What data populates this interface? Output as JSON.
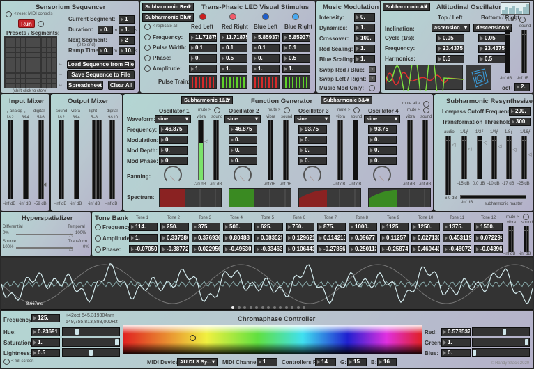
{
  "sequencer": {
    "title": "Sensorium Sequencer",
    "reset_midi": "< reset MIDI controls",
    "run": "Run",
    "presets_label": "Presets / Segments:",
    "shift_hint": "(shift-click to store)",
    "current_segment_label": "Current Segment:",
    "current_segment": "1",
    "duration_label": "Duration:",
    "duration_m": "0.",
    "duration_s": "1.",
    "next_segment_label": "Next Segment:",
    "next_segment_hint": "(0 to end)",
    "next_segment": "2",
    "ramp_label": "Ramp Time:",
    "ramp_m": "0.",
    "ramp_s": "10.",
    "unit_m": "m",
    "unit_s": "s",
    "load": "Load Sequence from File",
    "save": "Save Sequence to File",
    "spreadsheet": "Spreadsheet",
    "clear": "Clear All"
  },
  "led": {
    "title": "Trans-Phasic LED Visual Stimulus",
    "dropdown_red": "Subharmonic Red",
    "dropdown_blue": "Subharmonic Blue",
    "replicate": "< replicate all",
    "led_colors": [
      "#cc1f1f",
      "#f05a6a",
      "#1f5fcc",
      "#4aa8f0"
    ],
    "columns": [
      "Red Left",
      "Red Right",
      "Blue Left",
      "Blue Right"
    ],
    "rows": [
      {
        "label": "Frequency:",
        "values": [
          "11.71875",
          "11.71875",
          "5.859375",
          "5.859375"
        ]
      },
      {
        "label": "Pulse Width:",
        "values": [
          "0.1",
          "0.1",
          "0.1",
          "0.1"
        ]
      },
      {
        "label": "Phase:",
        "values": [
          "0.",
          "0.5",
          "0.",
          "0.5"
        ]
      },
      {
        "label": "Amplitude:",
        "values": [
          "1.",
          "1.",
          "1.",
          "1."
        ]
      }
    ],
    "pulse_train_label": "Pulse Train:",
    "pulse_colors": [
      "#d62a2a",
      "#5fd12a",
      "#d62a2a",
      "#5fd12a"
    ]
  },
  "music_mod": {
    "title": "Music Modulation",
    "rows": [
      {
        "label": "Intensity:",
        "value": "0."
      },
      {
        "label": "Dynamics:",
        "value": "1."
      },
      {
        "label": "Crossover:",
        "value": "100."
      },
      {
        "label": "Red Scaling:",
        "value": "1."
      },
      {
        "label": "Blue Scaling:",
        "value": "1."
      }
    ],
    "swap_rb": "Swap Red / Blue:",
    "swap_lr": "Swap Left / Right:",
    "mod_only": "Music Mod Only:"
  },
  "altitudinal": {
    "title": "Altitudinal Oscillator",
    "dropdown": "Subharmonic All",
    "top_left": "Top / Left",
    "bottom_right": "Bottom / Right",
    "inclination_label": "Inclination:",
    "inclination": [
      "ascension",
      "descension"
    ],
    "cycle_label": "Cycle (1/s):",
    "cycle": [
      "0.05",
      "0.05"
    ],
    "frequency_label": "Frequency:",
    "frequency": [
      "23.4375",
      "23.4375"
    ],
    "harmonics_label": "Harmonics:",
    "harmonics": [
      "0.5",
      "0.5"
    ],
    "mute": "mute >",
    "vibra": "vibra",
    "sound": "sound",
    "db": [
      "-inf dB",
      "-inf dB"
    ],
    "oct_label": "oct+:",
    "oct": "2."
  },
  "input_mixer": {
    "title": "Input Mixer",
    "group_analog": "┌ analog ┐",
    "group_digital": "digital",
    "channels": [
      "1&2",
      "3&4",
      "5&6"
    ],
    "db": [
      "-inf dB",
      "-inf dB",
      "-59 dB"
    ]
  },
  "output_mixer": {
    "title": "Output Mixer",
    "groups": [
      "sound",
      "vibra",
      "light",
      "digital"
    ],
    "channels": [
      "1&2",
      "3&4",
      "5–8",
      "9&10"
    ],
    "db": [
      "-inf dB",
      "-inf dB",
      "-inf dB",
      "-inf dB"
    ]
  },
  "function_gen": {
    "title": "Function Generator",
    "dropdown_12": "Subharmonic 1&2",
    "dropdown_34": "Subharmonic 3&4",
    "mute_all": "mute all >",
    "mute": "mute >",
    "vibra": "vibra",
    "sound": "sound",
    "labels": {
      "waveform": "Waveform:",
      "frequency": "Frequency:",
      "modulation": "Modulation:",
      "mod_depth": "Mod Depth:",
      "mod_phase": "Mod Phase:",
      "panning": "Panning:",
      "spectrum": "Spectrum:"
    },
    "oscillators": [
      {
        "name": "Oscillator 1",
        "waveform": "sine",
        "frequency": "46.875",
        "modulation": "0.",
        "mod_depth": "0.",
        "mod_phase": "0.",
        "vibra_db": "-20 dB",
        "sound_db": "-inf dB",
        "vibra_level": 0.62,
        "spectrum_color": "#8a2222"
      },
      {
        "name": "Oscillator 2",
        "waveform": "sine",
        "frequency": "46.875",
        "modulation": "0.",
        "mod_depth": "0.",
        "mod_phase": "0.",
        "vibra_db": "-inf dB",
        "sound_db": "-inf dB",
        "vibra_level": 0,
        "spectrum_color": "#3a8a22"
      },
      {
        "name": "Oscillator 3",
        "waveform": "sine",
        "frequency": "93.75",
        "modulation": "0.",
        "mod_depth": "0.",
        "mod_phase": "0.",
        "vibra_db": "-inf dB",
        "sound_db": "-inf dB",
        "vibra_level": 0,
        "spectrum_color": "#8a2222"
      },
      {
        "name": "Oscillator 4",
        "waveform": "sine",
        "frequency": "93.75",
        "modulation": "0.",
        "mod_depth": "0.",
        "mod_phase": "0.",
        "vibra_db": "-inf dB",
        "sound_db": "-inf dB",
        "vibra_level": 0,
        "spectrum_color": "#3a8a22"
      }
    ]
  },
  "resynth": {
    "title": "Subharmonic Resynthesizer",
    "lowpass_label": "Lowpass Cutoff Frequency:",
    "lowpass": "200.",
    "threshold_label": "Transformation Threshold:",
    "threshold": "300.",
    "channels": [
      "audio",
      "1/1ƒ",
      "1/2ƒ",
      "1/4ƒ",
      "1/8ƒ",
      "1/16ƒ"
    ],
    "db": [
      "-6.0 dB",
      "-15 dB",
      "0.0 dB",
      "-10 dB",
      "-17 dB",
      "-25 dB"
    ],
    "master_db": "-inf dB",
    "master_label": "subharmonic master"
  },
  "hyperspatializer": {
    "title": "Hyperspatializer",
    "differential": "Differential",
    "temporal": "Temporal",
    "diff_pct": "0%",
    "temp_pct": "100%",
    "source": "Source",
    "transform": "Transform",
    "src_pct": "100%",
    "trans_pct": "0%",
    "slider1": 1.0,
    "slider2": 0.0
  },
  "tone_bank": {
    "title": "Tone Bank",
    "row_labels": [
      "Frequency:",
      "Amplitude:",
      "Phase:"
    ],
    "tones": [
      "Tone 1",
      "Tone 2",
      "Tone 3",
      "Tone 4",
      "Tone 5",
      "Tone 6",
      "Tone 7",
      "Tone 8",
      "Tone 9",
      "Tone 10",
      "Tone 11",
      "Tone 12"
    ],
    "frequency": [
      "114.",
      "250.",
      "375.",
      "500.",
      "625.",
      "750.",
      "875.",
      "1000.",
      "1125.",
      "1250.",
      "1375.",
      "1500."
    ],
    "amplitude": [
      "1.",
      "0.337386",
      "0.376936",
      "0.80488",
      "0.083525",
      "0.129621",
      "0.114215",
      "0.09677",
      "0.11257",
      "0.027133",
      "0.453119",
      "0.072294"
    ],
    "phase": [
      "-0.070508",
      "-0.387725",
      "0.022956",
      "-0.495308",
      "-0.334632",
      "0.106443",
      "-0.278561",
      "0.250113",
      "-0.258741",
      "0.460441",
      "-0.480726",
      "-0.043966"
    ],
    "mute": "mute >",
    "vibra": "vibra",
    "sound": "sound",
    "db": [
      "-inf dB",
      "-inf dB"
    ]
  },
  "scope": {
    "timescale": "8.667ms",
    "pages": 13,
    "active_page": 1
  },
  "chromaphase": {
    "title": "Chromaphase Controller",
    "frequency_label": "Frequency:",
    "frequency": "125.",
    "octave_info": "+42oct   545.319304nm",
    "hz_info": "549,755,813,888,000Hz",
    "hue_label": "Hue:",
    "hue": "0.23691",
    "saturation_label": "Saturation:",
    "saturation": "1.",
    "lightness_label": "Lightness:",
    "lightness": "0.5",
    "hue_value": 0.23691,
    "saturation_value": 1.0,
    "lightness_value": 0.5,
    "red_label": "Red:",
    "red": "0.578537",
    "green_label": "Green:",
    "green": "1.",
    "blue_label": "Blue:",
    "blue": "0.",
    "red_value": 0.578537,
    "green_value": 1.0,
    "blue_value": 0.0,
    "full_screen": "< full screen",
    "midi_device_label": "MIDI Device:",
    "midi_device": "AU DLS Sy...",
    "midi_channel_label": "MIDI Channel:",
    "midi_channel": "1",
    "controllers_r_label": "Controllers R:",
    "controllers_r": "14",
    "g_label": "G:",
    "controllers_g": "15",
    "b_label": "B:",
    "controllers_b": "16",
    "copyright": "© Randy Stack 2020"
  }
}
